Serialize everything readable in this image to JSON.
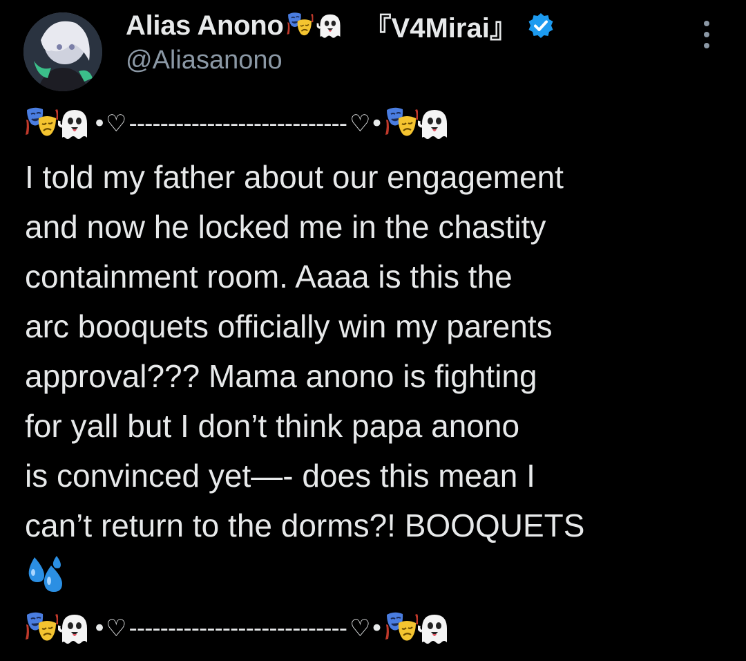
{
  "author": {
    "display_name": "Alias Anono",
    "name_emojis": [
      "performing-arts-emoji",
      "ghost-emoji"
    ],
    "tag": "『V4Mirai』",
    "verified": true,
    "handle": "@Aliasanono"
  },
  "divider": {
    "left_sep": "•♡",
    "dashes": "----------------------------",
    "right_sep": "♡•"
  },
  "post": {
    "lines": [
      "I told my father about our engagement",
      "and now he locked me in the chastity",
      "containment room. Aaaa is this the",
      "arc booquets officially win my parents",
      "approval??? Mama anono is fighting",
      "for yall but I don’t think papa anono",
      "is convinced yet—- does this mean I",
      "can’t return to the dorms?! BOOQUETS"
    ],
    "trailing_emoji": "sweat-droplets-emoji"
  },
  "colors": {
    "background": "#000000",
    "text": "#e7e9ea",
    "secondary_text": "#8b98a5",
    "verified_blue": "#1d9bf0"
  }
}
